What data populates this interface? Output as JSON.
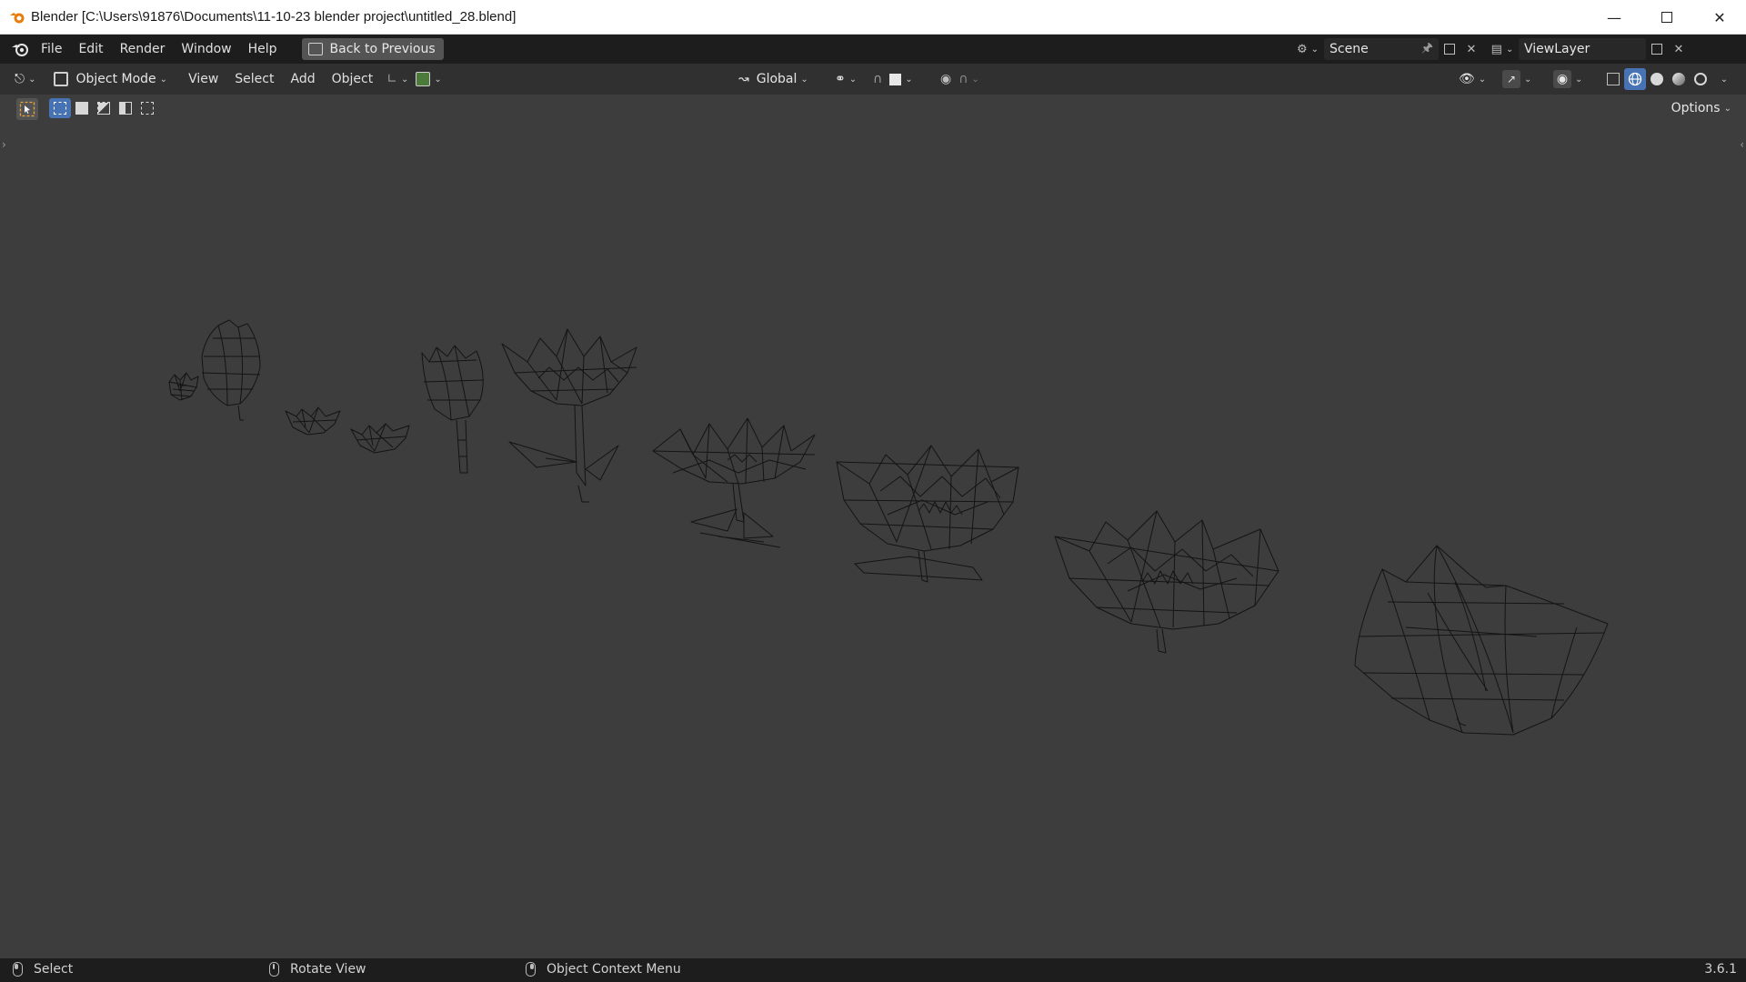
{
  "window": {
    "title": "Blender [C:\\Users\\91876\\Documents\\11-10-23 blender project\\untitled_28.blend]",
    "controls": [
      "minimize-icon",
      "maximize-icon",
      "close-icon"
    ]
  },
  "topbar": {
    "menus": [
      "File",
      "Edit",
      "Render",
      "Window",
      "Help"
    ],
    "back_button": "Back to Previous",
    "scene": "Scene",
    "view_layer": "ViewLayer"
  },
  "viewport_header": {
    "mode": "Object Mode",
    "menus": [
      "View",
      "Select",
      "Add",
      "Object"
    ],
    "transform_orientation": "Global",
    "shading_active": "wireframe"
  },
  "tool_settings": {
    "options": "Options"
  },
  "viewport": {
    "display": "wireframe",
    "objects": [
      "flower-bud-small",
      "flower-bud",
      "flower-opening-small",
      "flower-opening-small-2",
      "flower-bud-stem",
      "flower-with-leaves",
      "flower-with-stem",
      "flower-open",
      "flower-open-large",
      "flower-full-bloom",
      "flower-closed-large"
    ]
  },
  "statusbar": {
    "select": "Select",
    "rotate": "Rotate View",
    "context_menu": "Object Context Menu",
    "version": "3.6.1"
  },
  "colors": {
    "background": "#3d3d3d",
    "header": "#303030",
    "topbar": "#1d1d1d",
    "accent": "#4772b3",
    "wire": "#141414"
  }
}
